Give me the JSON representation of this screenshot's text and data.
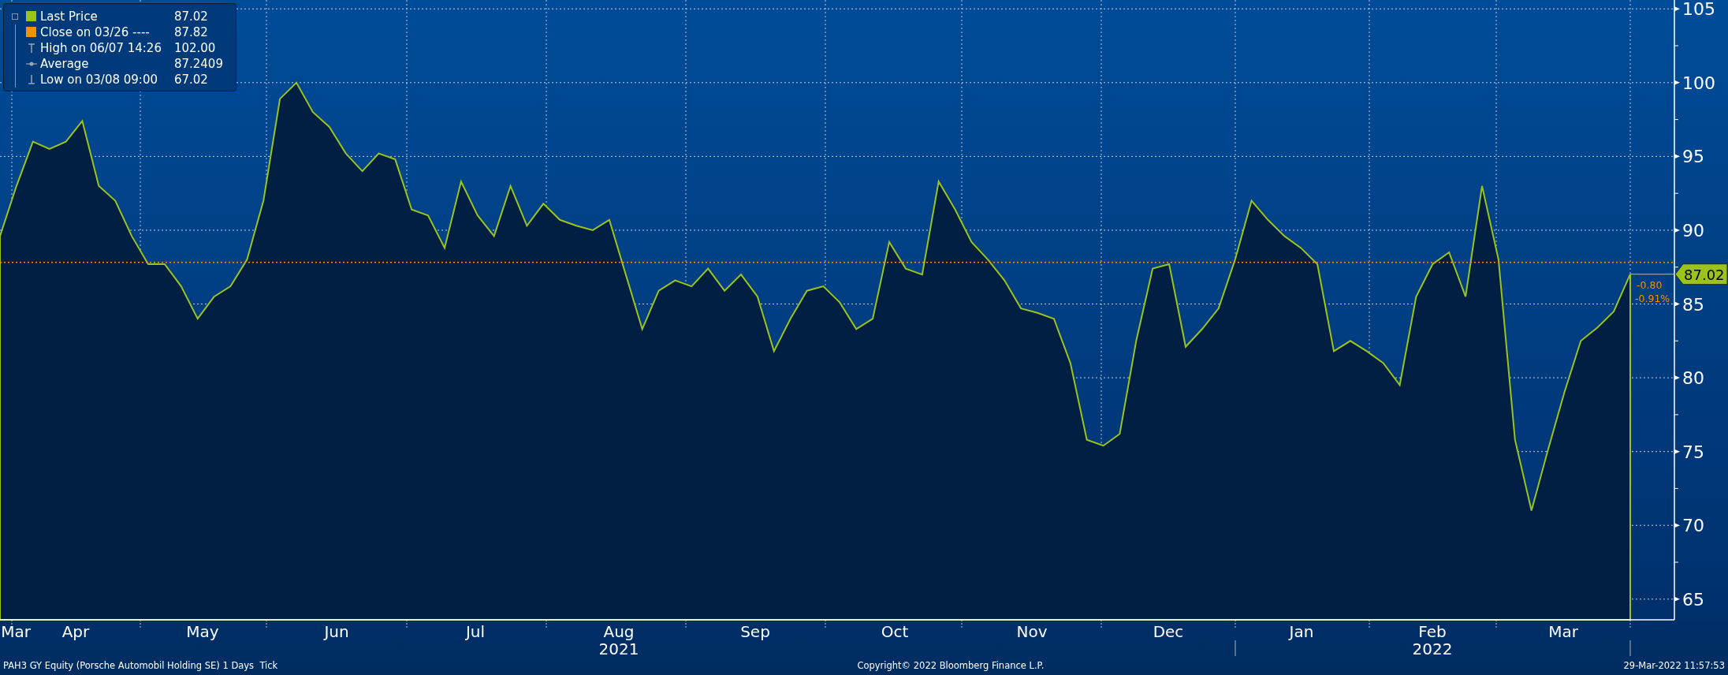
{
  "chart": {
    "legend": [
      {
        "kind": "swatch",
        "label": "Last Price",
        "value": "87.02",
        "color": "#9bc31c"
      },
      {
        "kind": "swatch",
        "label": "Close on 03/26 ----",
        "value": "87.82",
        "color": "#f39200"
      },
      {
        "kind": "high",
        "label": "High on 06/07 14:26",
        "value": "102.00"
      },
      {
        "kind": "average",
        "label": "Average",
        "value": "87.2409"
      },
      {
        "kind": "low",
        "label": "Low on 03/08 09:00",
        "value": "67.02"
      }
    ],
    "last_price": {
      "tag": "87.02",
      "change": "-0.80",
      "change_pct": "-0.91%"
    },
    "month_labels": [
      "Mar",
      "Apr",
      "May",
      "Jun",
      "Jul",
      "Aug",
      "Sep",
      "Oct",
      "Nov",
      "Dec",
      "Jan",
      "Feb",
      "Mar"
    ],
    "year_labels": [
      "2021",
      "2022"
    ],
    "chart_data": {
      "type": "area",
      "grid": true,
      "ylim": [
        63.6,
        105.6
      ],
      "yticks": [
        65,
        70,
        75,
        80,
        85,
        90,
        95,
        100,
        105
      ],
      "ref_lines": [
        {
          "axis": "y",
          "value": 87.82,
          "color": "#f39200"
        }
      ],
      "series": [
        {
          "color": "#001f42",
          "values": [
            89.6,
            93,
            96,
            95.5,
            96,
            97.4,
            93,
            92,
            89.6,
            87.7,
            87.7,
            86.2,
            84,
            85.5,
            86.2,
            88,
            92,
            98.9,
            100,
            98,
            97,
            95.2,
            94,
            95.2,
            94.8,
            91.4,
            91,
            88.8,
            93.3,
            91,
            89.6,
            93,
            90.3,
            91.8,
            90.7,
            90.3,
            90,
            90.7,
            87,
            83.3,
            85.9,
            86.6,
            86.2,
            87.4,
            85.9,
            87,
            85.5,
            81.8,
            84,
            85.9,
            86.2,
            85.1,
            83.3,
            84,
            89.2,
            87.4,
            87,
            93.3,
            91.4,
            89.2,
            88,
            86.6,
            84.7,
            84.4,
            84,
            81,
            75.8,
            75.4,
            76.2,
            82.5,
            87.4,
            87.7,
            82.1,
            83.3,
            84.7,
            88,
            92,
            90.7,
            89.6,
            88.8,
            87.7,
            81.8,
            82.5,
            81.8,
            81,
            79.5,
            85.5,
            87.7,
            88.5,
            85.5,
            93,
            88,
            75.8,
            71,
            75.1,
            79,
            82.5,
            83.4,
            84.5,
            87.02
          ]
        }
      ]
    }
  },
  "footer": {
    "security": "PAH3 GY Equity (Porsche Automobil Holding SE) 1 Days  Tick",
    "copyright": "Copyright© 2022 Bloomberg Finance L.P.",
    "timestamp": "29-Mar-2022 11:57:53"
  }
}
